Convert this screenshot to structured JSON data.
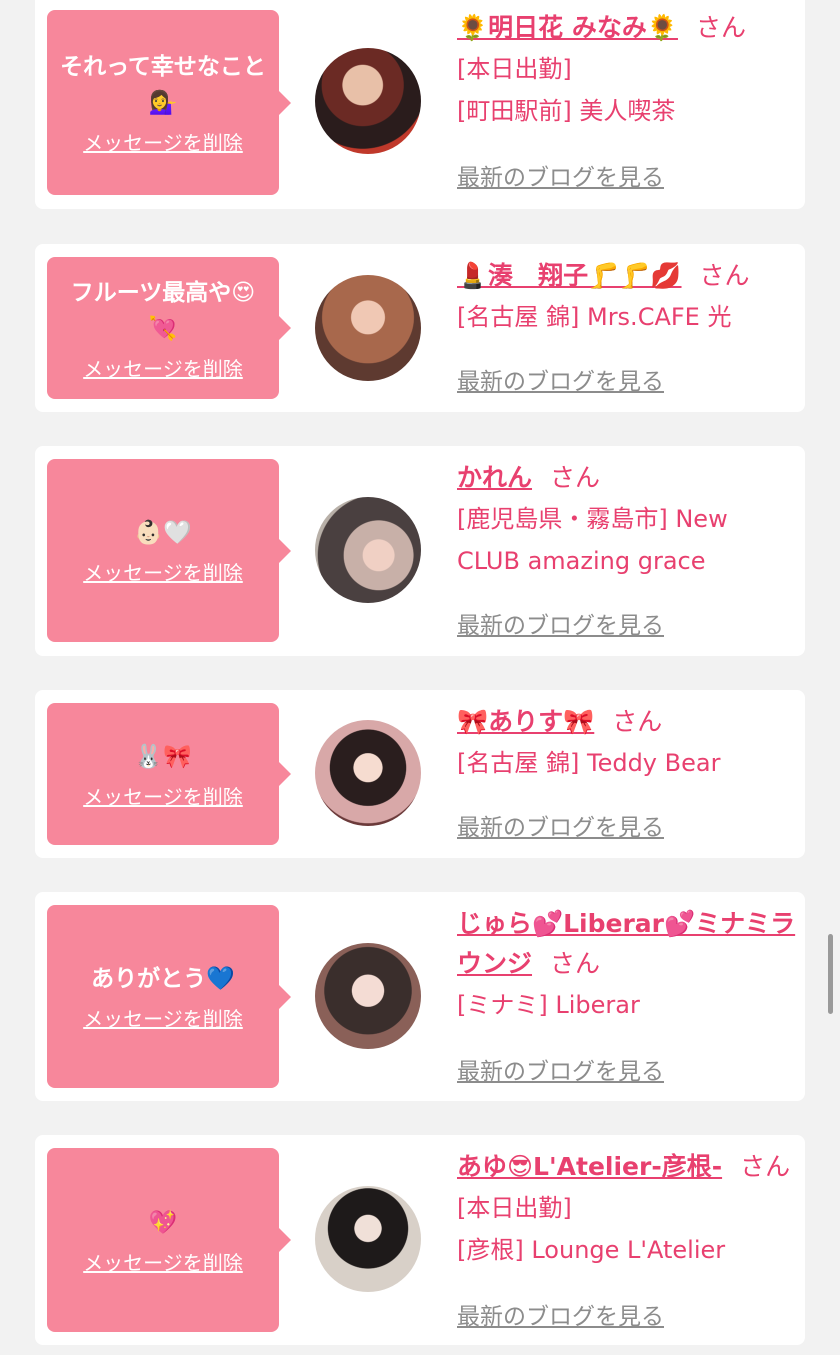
{
  "delete_label": "メッセージを削除",
  "blog_label": "最新のブログを見る",
  "san_label": "さん",
  "colors": {
    "accent": "#e8406f",
    "bubble": "#f7879b",
    "card": "#ffffff",
    "background": "#f2f2f2"
  },
  "cards": [
    {
      "message": "それって幸せなこと💁‍♀️",
      "name": "🌻明日花 みなみ🌻",
      "lines": [
        "[本日出勤]",
        "[町田駅前] 美人喫茶"
      ]
    },
    {
      "message": "フルーツ最高や😍💘",
      "name": "💄湊　翔子🦵🦵💋",
      "lines": [
        "[名古屋 錦] Mrs.CAFE 光"
      ]
    },
    {
      "message": "👶🏻🤍",
      "name": "かれん",
      "lines": [
        "[鹿児島県・霧島市] New",
        "CLUB amazing grace"
      ]
    },
    {
      "message": "🐰🎀",
      "name": "🎀ありす🎀",
      "lines": [
        "[名古屋 錦] Teddy Bear"
      ]
    },
    {
      "message": "ありがとう💙",
      "name": "じゅら💕Liberar💕ミナミラウンジ",
      "lines": [
        "[ミナミ] Liberar"
      ]
    },
    {
      "message": "💖",
      "name": "あゆ😎L'Atelier-彦根-",
      "lines": [
        "[本日出勤]",
        "[彦根] Lounge L'Atelier"
      ]
    }
  ]
}
